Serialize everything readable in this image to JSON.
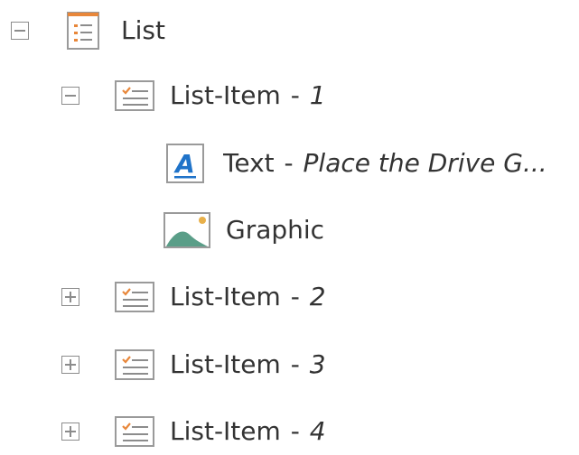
{
  "tree": {
    "root": {
      "label": "List",
      "icon": "list-icon",
      "expanded": true
    },
    "items": [
      {
        "label": "List-Item",
        "separator": " - ",
        "number": "1",
        "icon": "list-item-icon",
        "expanded": true,
        "children": [
          {
            "label": "Text",
            "separator": " - ",
            "value": "Place the Drive G...",
            "icon": "text-element-icon"
          },
          {
            "label": "Graphic",
            "icon": "graphic-image-icon"
          }
        ]
      },
      {
        "label": "List-Item",
        "separator": " - ",
        "number": "2",
        "icon": "list-item-icon",
        "expanded": false
      },
      {
        "label": "List-Item",
        "separator": " - ",
        "number": "3",
        "icon": "list-item-icon",
        "expanded": false
      },
      {
        "label": "List-Item",
        "separator": " - ",
        "number": "4",
        "icon": "list-item-icon",
        "expanded": false
      }
    ]
  },
  "colors": {
    "text": "#333333",
    "toggle_border": "#8c8c8c",
    "accent_orange": "#e8873a",
    "text_icon_blue": "#1f73c9",
    "graphic_green": "#5a9e88",
    "graphic_sun": "#e8b04a"
  }
}
